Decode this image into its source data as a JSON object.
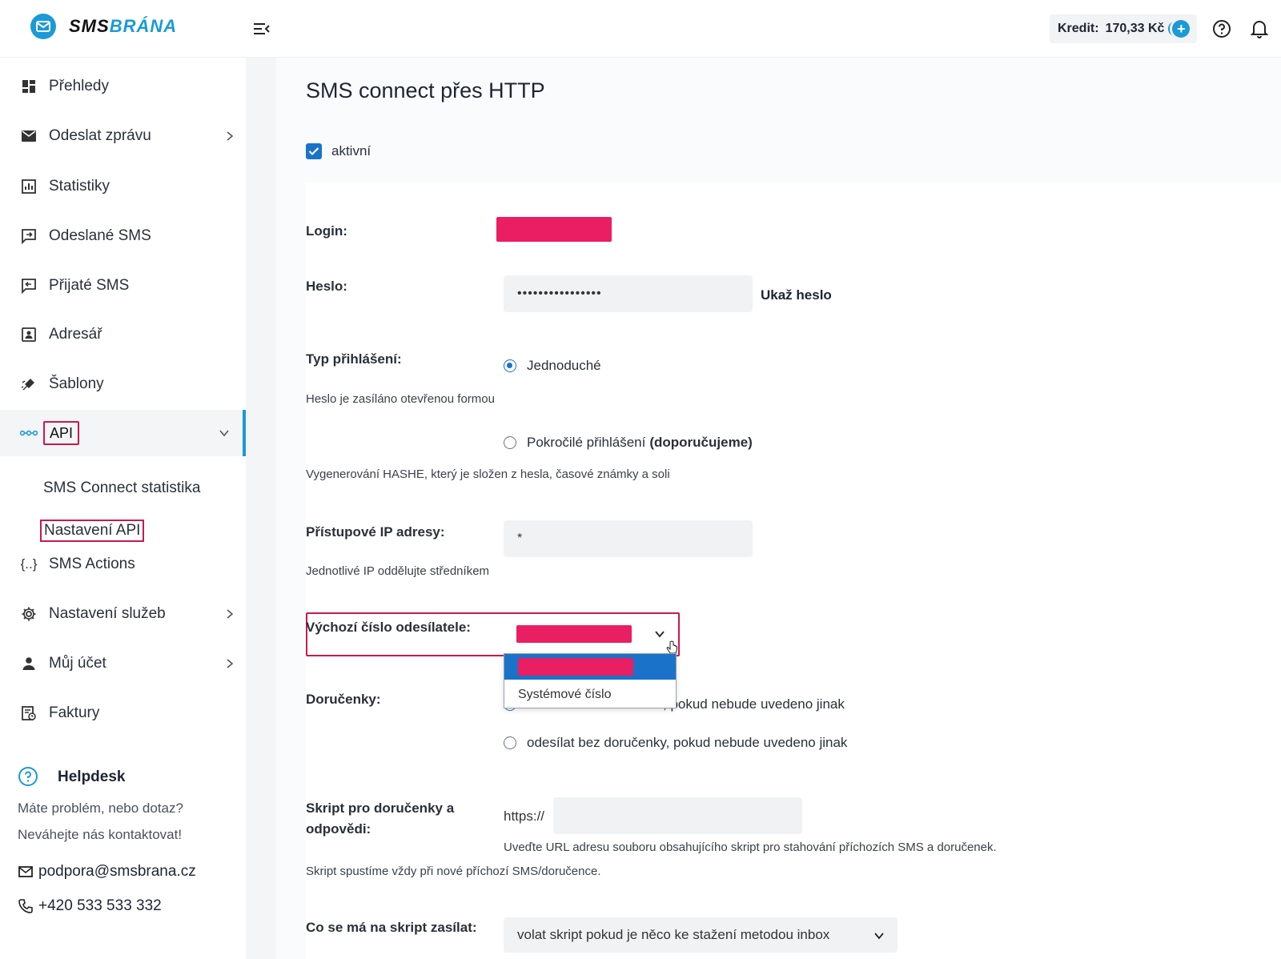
{
  "header": {
    "logo_sms": "SMS",
    "logo_brana": "BRÁNA",
    "credit_label": "Kredit:",
    "credit_amount": "170,33 Kč"
  },
  "sidebar": {
    "items": [
      {
        "label": "Přehledy",
        "icon": "dashboard-icon"
      },
      {
        "label": "Odeslat zprávu",
        "icon": "envelope-icon"
      },
      {
        "label": "Statistiky",
        "icon": "chart-icon"
      },
      {
        "label": "Odeslané SMS",
        "icon": "sms-sent-icon"
      },
      {
        "label": "Přijaté SMS",
        "icon": "sms-received-icon"
      },
      {
        "label": "Adresář",
        "icon": "contacts-icon"
      },
      {
        "label": "Šablony",
        "icon": "template-icon"
      },
      {
        "label": "API",
        "icon": "api-icon"
      },
      {
        "label": "SMS Actions",
        "icon": "braces-icon"
      },
      {
        "label": "Nastavení služeb",
        "icon": "gear-icon"
      },
      {
        "label": "Můj účet",
        "icon": "user-icon"
      },
      {
        "label": "Faktury",
        "icon": "invoice-icon"
      }
    ],
    "sub_items": [
      "SMS Connect statistika",
      "Nastavení API"
    ],
    "helpdesk": {
      "title": "Helpdesk",
      "line1": "Máte problém, nebo dotaz?",
      "line2": "Neváhejte nás kontaktovat!",
      "email": "podpora@smsbrana.cz",
      "phone": "+420 533 533 332"
    }
  },
  "main": {
    "title": "SMS connect přes HTTP",
    "active_label": "aktivní",
    "active_checked": true,
    "login_label": "Login:",
    "password_label": "Heslo:",
    "password_value": "••••••••••••••••",
    "show_password": "Ukaž heslo",
    "login_type_label": "Typ přihlášení:",
    "login_type_simple": "Jednoduché",
    "login_type_simple_hint": "Heslo je zasíláno otevřenou formou",
    "login_type_advanced": "Pokročilé přihlášení",
    "login_type_advanced_rec": "(doporučujeme)",
    "login_type_advanced_hint": "Vygenerování HASHE, který je složen z hesla, časové známky a soli",
    "ip_label": "Přístupové IP adresy:",
    "ip_value": "*",
    "ip_hint": "Jednotlivé IP oddělujte středníkem",
    "sender_label": "Výchozí číslo odesílatele:",
    "sender_option_system": "Systémové číslo",
    "receipts_label": "Doručenky:",
    "receipts_opt1_tail": ", pokud nebude uvedeno jinak",
    "receipts_opt2": "odesílat bez doručenky, pokud nebude uvedeno jinak",
    "script_label_1": "Skript pro doručenky a",
    "script_label_2": "odpovědi:",
    "script_prefix": "https://",
    "script_hint_1": "Uveďte URL adresu souboru obsahujícího skript pro stahování příchozích SMS a doručenek.",
    "script_hint_2": "Skript spustíme vždy při nové příchozí SMS/doručence.",
    "send_label": "Co se má na skript zasílat:",
    "send_value": "volat skript pokud je něco ke stažení metodou inbox"
  },
  "colors": {
    "accent": "#1a9ad6",
    "checkbox": "#1a73c9",
    "highlight_border": "#c8194f",
    "redaction": "#e91e63"
  }
}
